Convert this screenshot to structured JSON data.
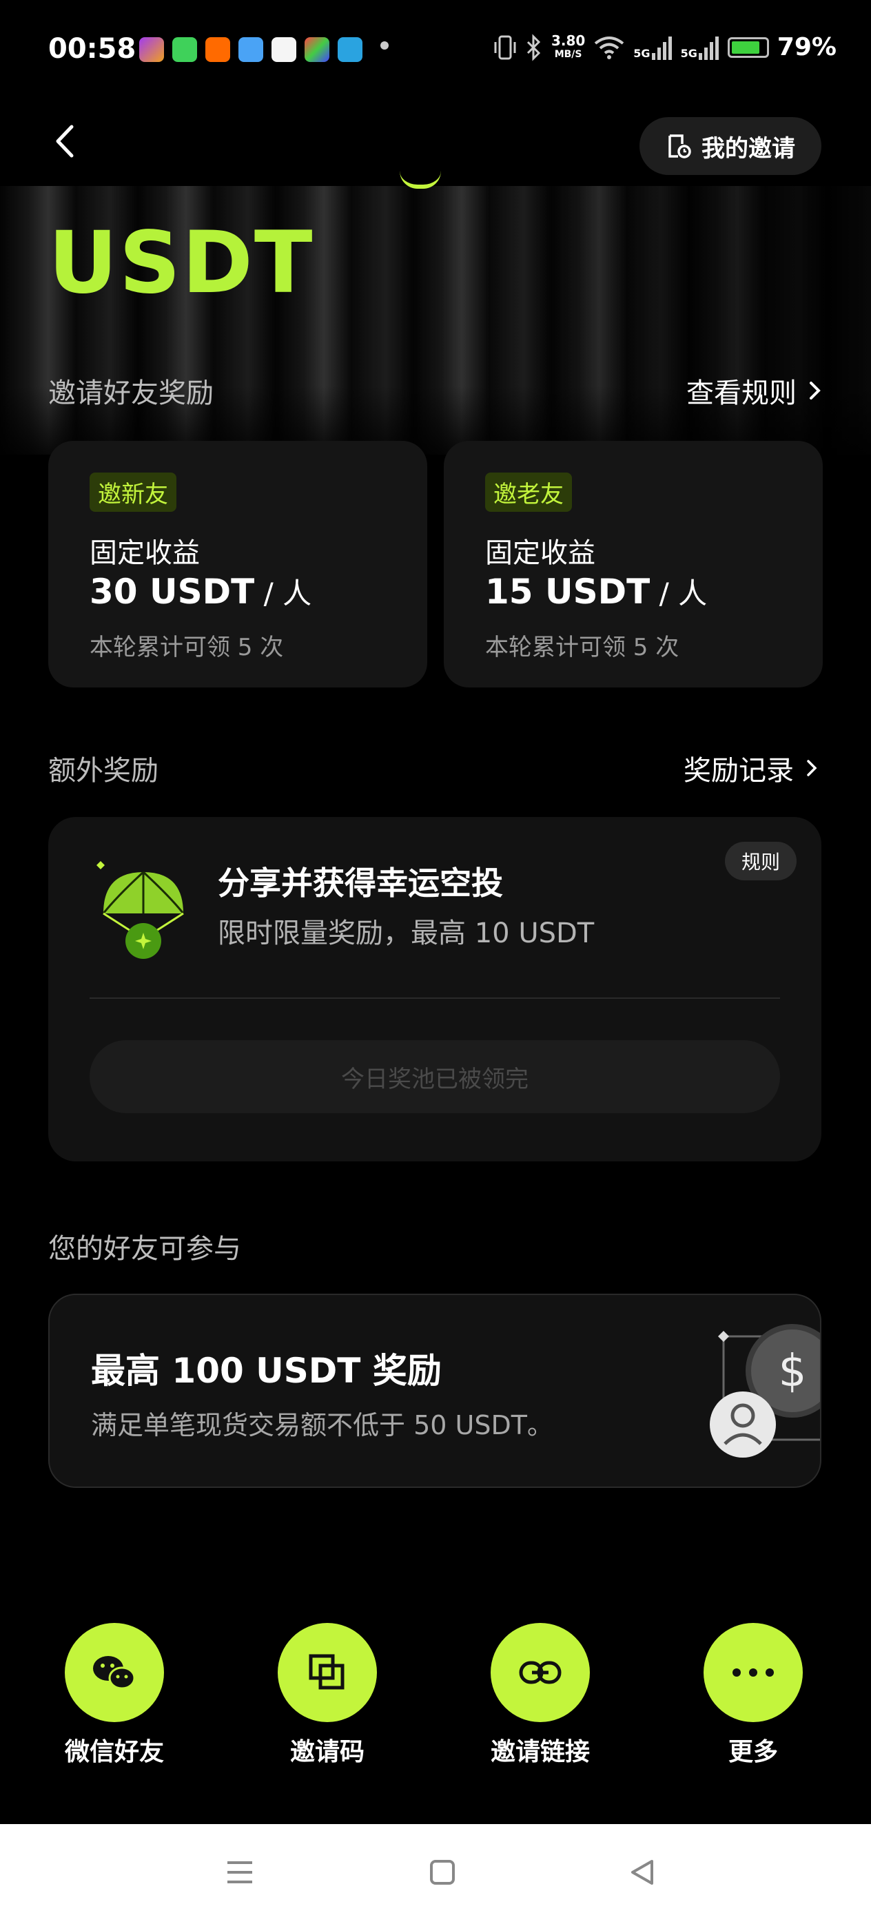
{
  "status_bar": {
    "time": "00:58",
    "speed_value": "3.80",
    "speed_unit": "MB/S",
    "network_1": "5G",
    "network_2": "5G",
    "battery": "79%"
  },
  "header": {
    "my_invite_label": "我的邀请"
  },
  "hero": {
    "title": "USDT"
  },
  "invite_section": {
    "label": "邀请好友奖励",
    "rules_link": "查看规则",
    "cards": [
      {
        "tag": "邀新友",
        "subtitle": "固定收益",
        "amount": "30 USDT",
        "unit": " / 人",
        "note": "本轮累计可领 5 次"
      },
      {
        "tag": "邀老友",
        "subtitle": "固定收益",
        "amount": "15 USDT",
        "unit": " / 人",
        "note": "本轮累计可领 5 次"
      }
    ]
  },
  "extra_section": {
    "label": "额外奖励",
    "records_link": "奖励记录",
    "airdrop": {
      "rules_label": "规则",
      "title": "分享并获得幸运空投",
      "description": "限时限量奖励，最高 10 USDT",
      "button_label": "今日奖池已被领完"
    }
  },
  "friends_section": {
    "label": "您的好友可参与",
    "title": "最高 100 USDT 奖励",
    "description": "满足单笔现货交易额不低于 50 USDT。"
  },
  "share_actions": [
    {
      "label": "微信好友",
      "icon": "wechat-icon"
    },
    {
      "label": "邀请码",
      "icon": "copy-icon"
    },
    {
      "label": "邀请链接",
      "icon": "link-icon"
    },
    {
      "label": "更多",
      "icon": "more-icon"
    }
  ],
  "colors": {
    "accent": "#c3f53c",
    "title_green": "#b5f23a",
    "card_bg": "#151515",
    "background": "#000000"
  }
}
